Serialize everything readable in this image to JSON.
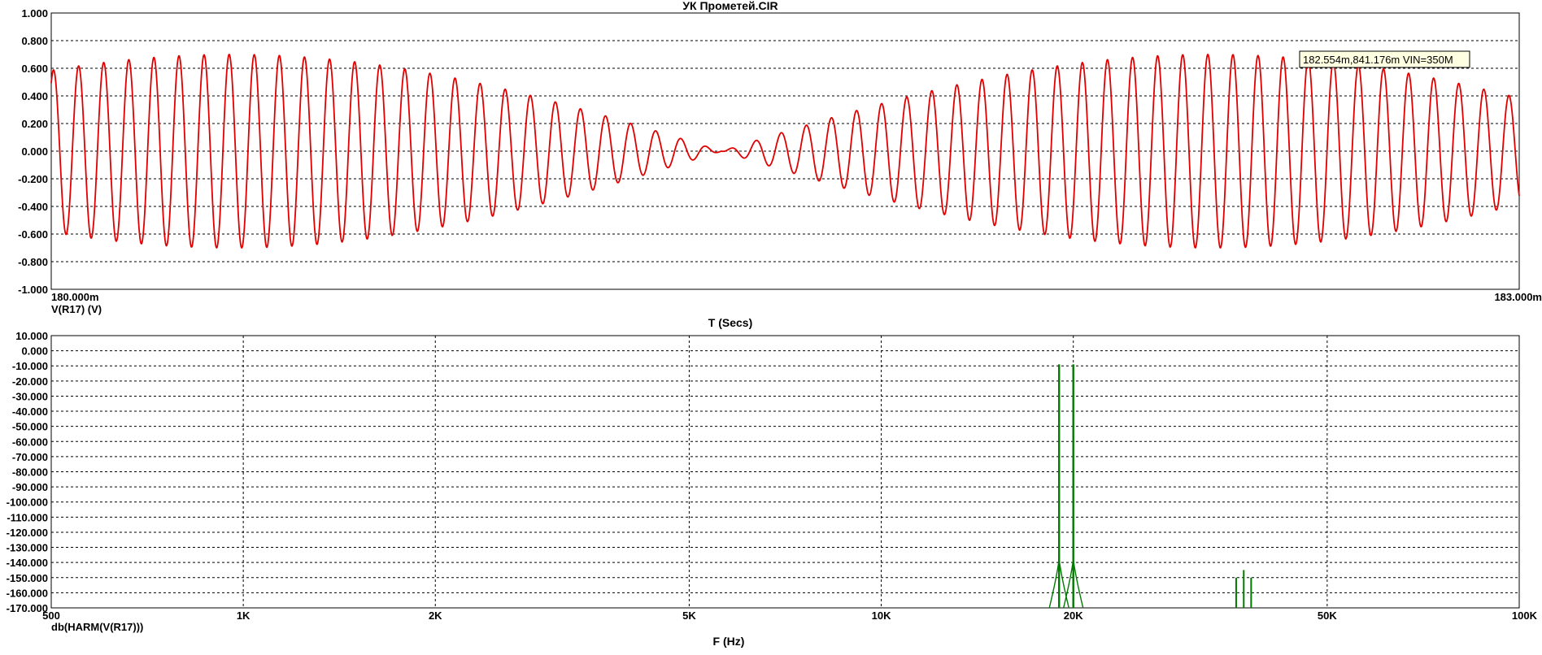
{
  "window": {
    "title": "УК Прометей.CIR"
  },
  "tooltip": {
    "text": "182.554m,841.176m VIN=350M"
  },
  "colors": {
    "time_trace": "#e00000",
    "harm_trace": "#007a00",
    "axis": "#000000"
  },
  "chart_data": [
    {
      "type": "line",
      "title": "УК Прометей.CIR",
      "xlabel": "T (Secs)",
      "series_label": "V(R17) (V)",
      "xlim": [
        0.18,
        0.183
      ],
      "x_tick_labels": [
        "180.000m",
        "183.000m"
      ],
      "ylim": [
        -1.0,
        1.0
      ],
      "y_ticks": [
        1.0,
        0.8,
        0.6,
        0.4,
        0.2,
        0.0,
        -0.2,
        -0.4,
        -0.6,
        -0.8,
        -1.0
      ],
      "y_tick_labels": [
        "1.000",
        "0.800",
        "0.600",
        "0.400",
        "0.200",
        "0.000",
        "-0.200",
        "-0.400",
        "-0.600",
        "-0.800",
        "-1.000"
      ],
      "grid": true,
      "series": [
        {
          "name": "V(R17) (V)",
          "carrier_hz": 19500,
          "beat_hz": 500,
          "amplitude": 0.7,
          "phase_offset_s": -0.00037
        }
      ]
    },
    {
      "type": "bar",
      "xlabel": "F (Hz)",
      "series_label": "db(HARM(V(R17)))",
      "xscale": "log",
      "xlim": [
        500,
        100000
      ],
      "x_ticks": [
        500,
        1000,
        2000,
        5000,
        10000,
        20000,
        50000,
        100000
      ],
      "x_tick_labels": [
        "500",
        "1K",
        "2K",
        "5K",
        "10K",
        "20K",
        "50K",
        "100K"
      ],
      "ylim": [
        -170,
        10
      ],
      "y_ticks": [
        10,
        0,
        -10,
        -20,
        -30,
        -40,
        -50,
        -60,
        -70,
        -80,
        -90,
        -100,
        -110,
        -120,
        -130,
        -140,
        -150,
        -160,
        -170
      ],
      "y_tick_labels": [
        "10.000",
        "0.000",
        "-10.000",
        "-20.000",
        "-30.000",
        "-40.000",
        "-50.000",
        "-60.000",
        "-70.000",
        "-80.000",
        "-90.000",
        "-100.000",
        "-110.000",
        "-120.000",
        "-130.000",
        "-140.000",
        "-150.000",
        "-160.000",
        "-170.000"
      ],
      "grid": true,
      "series": [
        {
          "name": "db(HARM(V(R17)))",
          "peaks": [
            {
              "x": 19000,
              "y": -9
            },
            {
              "x": 20000,
              "y": -9
            },
            {
              "x": 36000,
              "y": -150
            },
            {
              "x": 37000,
              "y": -145
            },
            {
              "x": 38000,
              "y": -150
            }
          ]
        }
      ]
    }
  ]
}
